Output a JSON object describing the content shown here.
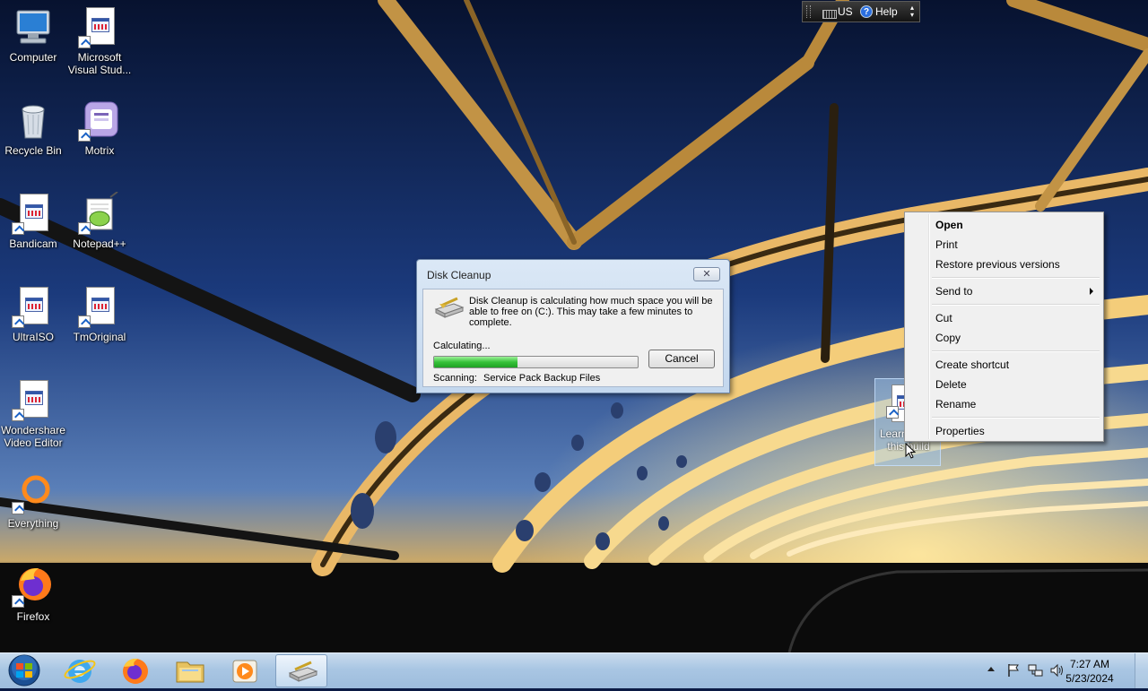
{
  "desktop": {
    "icons": [
      {
        "label": "Computer",
        "icon": "computer-icon"
      },
      {
        "label": "Microsoft Visual Stud...",
        "icon": "application-shortcut-icon"
      },
      {
        "label": "Recycle Bin",
        "icon": "recycle-bin-icon"
      },
      {
        "label": "Motrix",
        "icon": "motrix-icon"
      },
      {
        "label": "Bandicam",
        "icon": "application-shortcut-icon"
      },
      {
        "label": "Notepad++",
        "icon": "notepad-plus-plus-icon"
      },
      {
        "label": "UltraISO",
        "icon": "application-shortcut-icon"
      },
      {
        "label": "TmOriginal",
        "icon": "application-shortcut-icon"
      },
      {
        "label": "Wondershare Video Editor",
        "icon": "application-shortcut-icon"
      },
      {
        "label": "Everything",
        "icon": "everything-search-icon"
      },
      {
        "label": "Firefox",
        "icon": "firefox-icon"
      }
    ],
    "selected_icon": {
      "label": "Learn about this build",
      "icon": "application-shortcut-icon"
    }
  },
  "langbar": {
    "language": "US",
    "help": "Help"
  },
  "dialog": {
    "title": "Disk Cleanup",
    "close_glyph": "✕",
    "message": "Disk Cleanup is calculating how much space you will be able to free on  (C:). This may take a few minutes to complete.",
    "status_label": "Calculating...",
    "progress_fraction": 0.41,
    "cancel_label": "Cancel",
    "scanning_label": "Scanning:",
    "scanning_value": "Service Pack Backup Files"
  },
  "context_menu": {
    "open": "Open",
    "print": "Print",
    "restore": "Restore previous versions",
    "send_to": "Send to",
    "cut": "Cut",
    "copy": "Copy",
    "create_shortcut": "Create shortcut",
    "delete": "Delete",
    "rename": "Rename",
    "properties": "Properties"
  },
  "taskbar": {
    "start": "start-orb-icon",
    "pinned": [
      "internet-explorer-icon",
      "firefox-icon",
      "file-explorer-icon",
      "media-player-icon",
      "disk-cleanup-icon"
    ],
    "tray": [
      "show-hidden-icons-icon",
      "action-center-flag-icon",
      "network-icon",
      "volume-icon"
    ],
    "time": "7:27 AM",
    "date": "5/23/2024"
  },
  "colors": {
    "sky_top": "#0a1638",
    "sky_horizon": "#5a7fb8",
    "bridge_glow": "#f2c05a",
    "progress_green": "#37c23a",
    "taskbar": "#a9c6e3"
  }
}
